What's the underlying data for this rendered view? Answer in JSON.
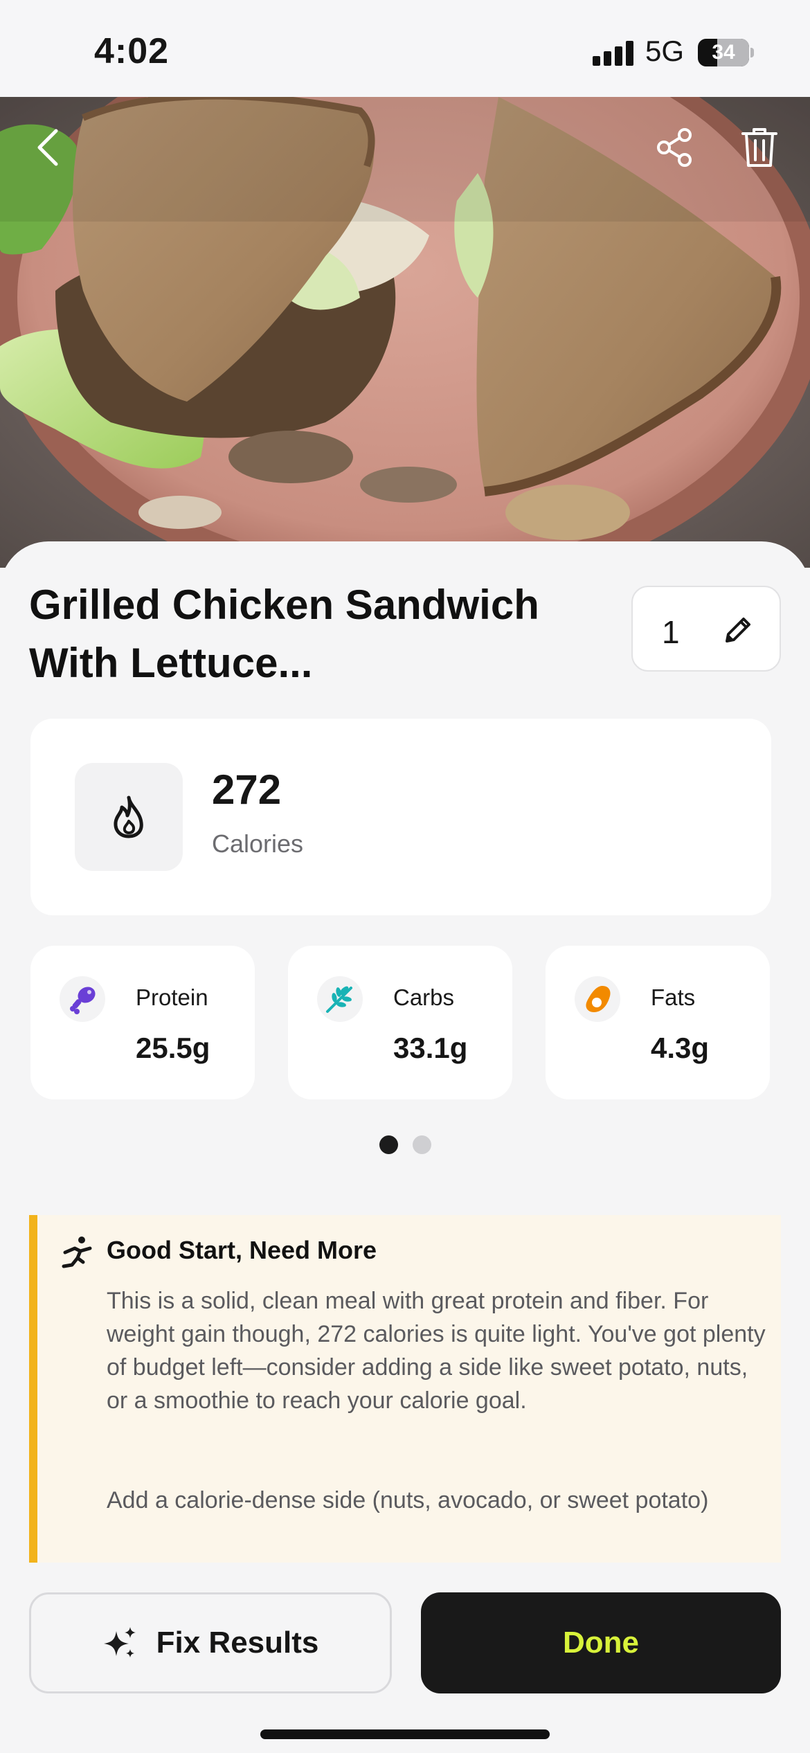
{
  "status_bar": {
    "time": "4:02",
    "network": "5G",
    "battery": "34",
    "battery_percent": 34
  },
  "header": {
    "back_icon": "chevron-left-icon",
    "share_icon": "share-icon",
    "delete_icon": "trash-icon"
  },
  "food": {
    "title": "Grilled Chicken Sandwich With Lettuce...",
    "quantity": "1",
    "edit_icon": "pencil-icon"
  },
  "calories": {
    "value": "272",
    "label": "Calories",
    "icon": "flame-icon"
  },
  "macros": [
    {
      "label": "Protein",
      "value": "25.5g",
      "icon": "drumstick-icon",
      "color": "#6a3fd6"
    },
    {
      "label": "Carbs",
      "value": "33.1g",
      "icon": "wheat-icon",
      "color": "#19b3b5"
    },
    {
      "label": "Fats",
      "value": "4.3g",
      "icon": "avocado-icon",
      "color": "#f28a00"
    }
  ],
  "pager": {
    "pages": 2,
    "active": 1,
    "active_color": "#1c1c1c",
    "inactive_color": "#cfcfd2"
  },
  "insight": {
    "title": "Good Start, Need More",
    "body": "This is a solid, clean meal with great protein and fiber. For weight gain though, 272 calories is quite light. You've got plenty of budget left—consider adding a side like sweet potato, nuts, or a smoothie to reach your calorie goal.",
    "tip": "Add a calorie-dense side (nuts, avocado, or sweet potato)",
    "accent_color": "#f2b31b",
    "icon": "running-person-icon"
  },
  "actions": {
    "fix_label": "Fix Results",
    "fix_icon": "sparkles-icon",
    "done_label": "Done",
    "done_text_color": "#d8f23a"
  }
}
